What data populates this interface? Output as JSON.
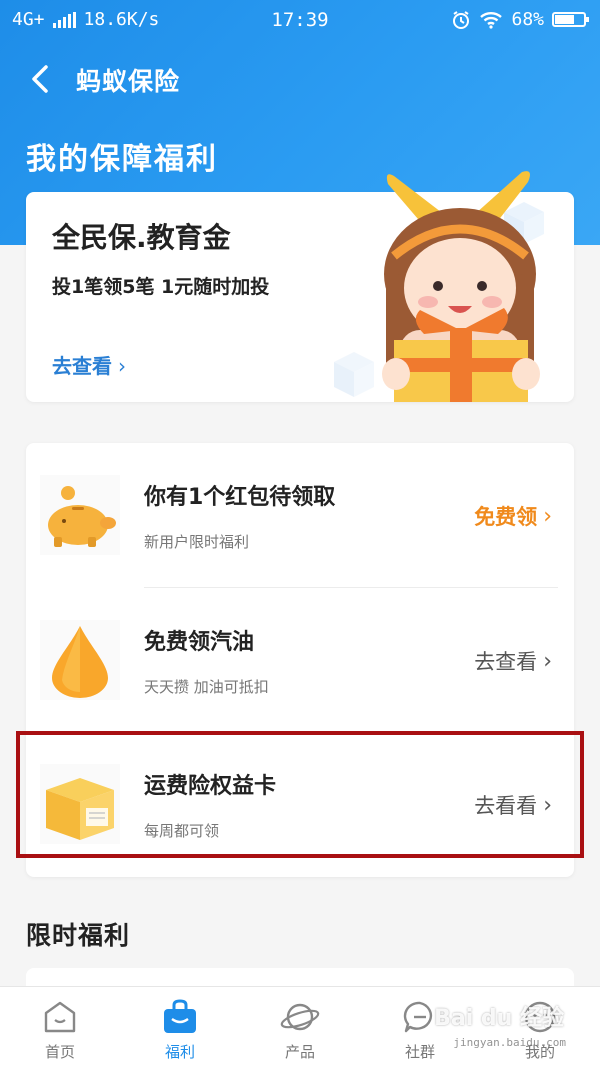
{
  "status_bar": {
    "network": "4G+",
    "speed": "18.6K/s",
    "time": "17:39",
    "battery": "68%",
    "battery_level": 0.68
  },
  "navbar": {
    "title": "蚂蚁保险"
  },
  "main_title": "我的保障福利",
  "promo": {
    "title": "全民保.教育金",
    "subtitle": "投1笔领5笔 1元随时加投",
    "link": "去查看",
    "chevron": "›"
  },
  "benefits": [
    {
      "title": "你有1个红包待领取",
      "subtitle": "新用户限时福利",
      "action": "免费领",
      "icon": "piggy-bank-icon"
    },
    {
      "title": "免费领汽油",
      "subtitle": "天天攒 加油可抵扣",
      "action": "去查看",
      "icon": "oil-drop-icon"
    },
    {
      "title": "运费险权益卡",
      "subtitle": "每周都可领",
      "action": "去看看",
      "icon": "parcel-box-icon"
    }
  ],
  "chevron": "›",
  "limited_section_title": "限时福利",
  "tabs": [
    {
      "label": "首页",
      "icon": "home-icon",
      "active": false
    },
    {
      "label": "福利",
      "icon": "gift-bag-icon",
      "active": true
    },
    {
      "label": "产品",
      "icon": "planet-icon",
      "active": false
    },
    {
      "label": "社群",
      "icon": "chat-bubble-icon",
      "active": false
    },
    {
      "label": "我的",
      "icon": "profile-icon",
      "active": false
    }
  ],
  "watermark": {
    "text": "Bai du 经验",
    "sub": "jingyan.baidu.com"
  },
  "colors": {
    "brand_blue": "#1e8de8",
    "orange": "#f08a1c",
    "highlight_red": "#a90f12"
  }
}
